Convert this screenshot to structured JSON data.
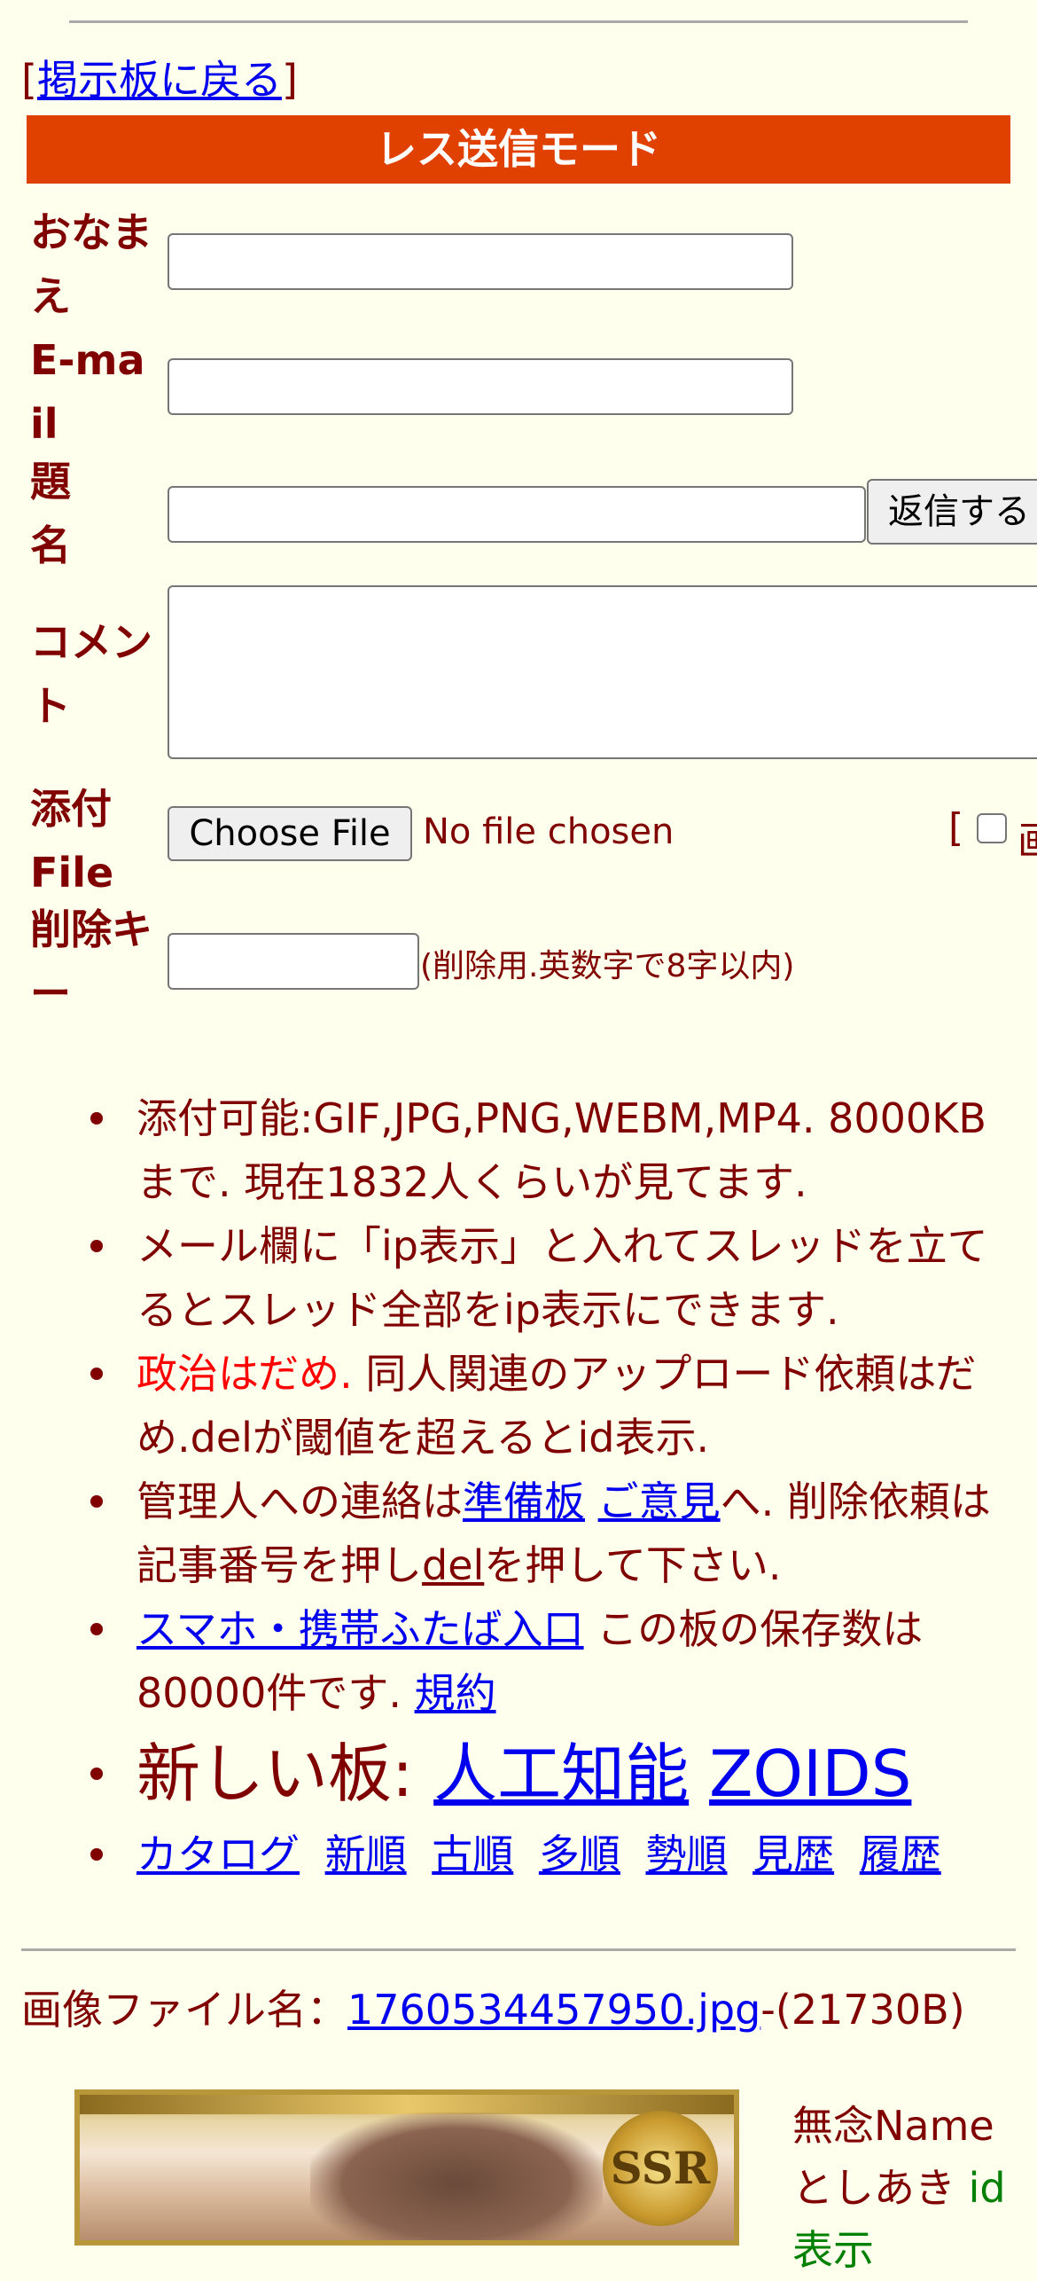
{
  "nav": {
    "back_open": "[",
    "back_link": "掲示板に戻る",
    "back_close": "]"
  },
  "mode_title": "レス送信モード",
  "form": {
    "name_label": "おなまえ",
    "email_label": "E-mail",
    "subject_label": "題名",
    "submit_label": "返信する",
    "comment_label": "コメント",
    "file_label": "添付File",
    "choose_file_label": "Choose File",
    "no_file_text": "No file chosen",
    "extra_open": "[",
    "extra_text": "画",
    "delkey_label": "削除キー",
    "delkey_hint": "(削除用.英数字で8字以内)"
  },
  "rules": {
    "r1": "添付可能:GIF,JPG,PNG,WEBM,MP4. 8000KBまで. 現在1832人くらいが見てます.",
    "r2": "メール欄に「ip表示」と入れてスレッドを立てるとスレッド全部をip表示にできます.",
    "r3_red": "政治はだめ.",
    "r3_rest": " 同人関連のアップロード依頼はだめ.delが閾値を超えるとid表示.",
    "r4_a": "管理人への連絡は",
    "r4_link1": "準備板",
    "r4_link2": "ご意見",
    "r4_b": "へ. 削除依頼は記事番号を押し",
    "r4_link3": "del",
    "r4_c": "を押して下さい.",
    "r5_link": "スマホ・携帯ふたば入口",
    "r5_text": " この板の保存数は80000件です. ",
    "r5_link2": "規約",
    "r6_text": "新しい板: ",
    "r6_link1": "人工知能",
    "r6_link2": "ZOIDS",
    "catalog_links": [
      "カタログ",
      "新順",
      "古順",
      "多順",
      "勢順",
      "見歴",
      "履歴"
    ]
  },
  "post": {
    "filename_label": "画像ファイル名：",
    "filename_link": "1760534457950.jpg",
    "filesize": "-(21730B)",
    "badge_text": "SSR",
    "name": "無念Name",
    "poster": "としあき",
    "id_text": "id",
    "id_display": "表示"
  }
}
